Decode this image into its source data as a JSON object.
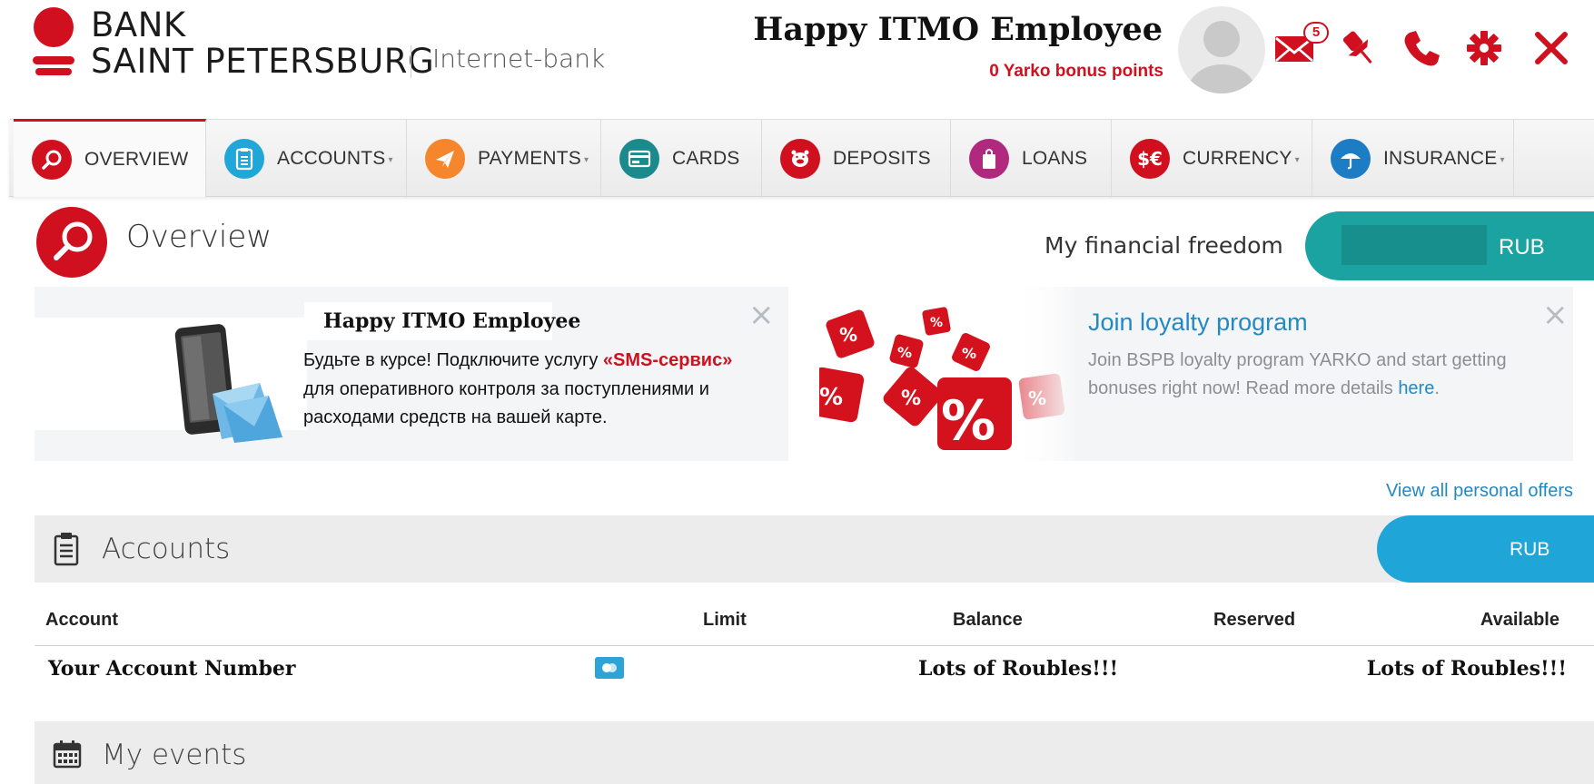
{
  "brand": {
    "line1": "BANK",
    "line2": "SAINT PETERSBURG",
    "subtitle": "Internet-bank",
    "color": "#d0101f"
  },
  "user": {
    "name": "Happy ITMO Employee",
    "bonus": "0 Yarko bonus points",
    "messages_count": "5"
  },
  "header_icons": [
    "mail-icon",
    "pin-icon",
    "phone-icon",
    "gear-icon",
    "close-icon"
  ],
  "nav": {
    "items": [
      {
        "label": "OVERVIEW",
        "icon": "search-icon",
        "color": "#d0101f",
        "active": true,
        "dropdown": false
      },
      {
        "label": "ACCOUNTS",
        "icon": "clipboard-icon",
        "color": "#21a6d8",
        "active": false,
        "dropdown": true
      },
      {
        "label": "PAYMENTS",
        "icon": "paper-plane-icon",
        "color": "#f5862b",
        "active": false,
        "dropdown": true
      },
      {
        "label": "CARDS",
        "icon": "card-icon",
        "color": "#1a8a8d",
        "active": false,
        "dropdown": false
      },
      {
        "label": "DEPOSITS",
        "icon": "piggy-bank-icon",
        "color": "#d0101f",
        "active": false,
        "dropdown": false
      },
      {
        "label": "LOANS",
        "icon": "bag-icon",
        "color": "#b0297f",
        "active": false,
        "dropdown": false
      },
      {
        "label": "CURRENCY",
        "icon": "currency-icon",
        "color": "#d0101f",
        "active": false,
        "dropdown": true
      },
      {
        "label": "INSURANCE",
        "icon": "umbrella-icon",
        "color": "#1d7dc4",
        "active": false,
        "dropdown": true
      }
    ]
  },
  "overview": {
    "title": "Overview",
    "freedom_label": "My financial freedom",
    "freedom_currency": "RUB"
  },
  "sms_banner": {
    "name": "Happy ITMO Employee",
    "text_before": "Будьте в курсе! Подключите услугу ",
    "highlight": "«SMS-сервис»",
    "text_after": " для оперативного контроля за поступлениями и расходами средств на вашей карте."
  },
  "loyalty_banner": {
    "title": "Join loyalty program",
    "text": "Join BSPB loyalty program YARKO and start getting bonuses right now! Read more details ",
    "link": "here",
    "tail": "."
  },
  "view_all": "View all personal offers",
  "accounts": {
    "title": "Accounts",
    "currency": "RUB",
    "columns": [
      "Account",
      "Limit",
      "Balance",
      "Reserved",
      "Available"
    ],
    "rows": [
      {
        "account": "Your Account Number",
        "limit": "",
        "balance": "Lots of Roubles!!!",
        "reserved": "",
        "available": "Lots of Roubles!!!"
      }
    ]
  },
  "events": {
    "title": "My events"
  }
}
